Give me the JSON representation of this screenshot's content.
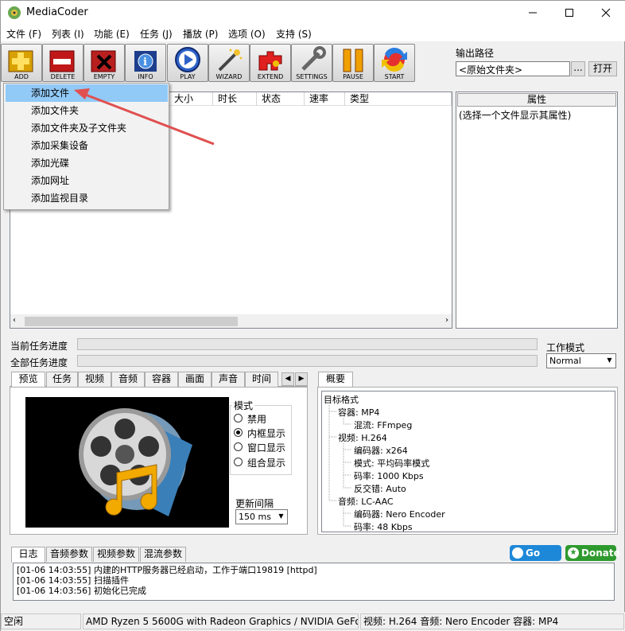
{
  "window": {
    "title": "MediaCoder"
  },
  "menubar": [
    "文件 (F)",
    "列表 (I)",
    "功能 (E)",
    "任务 (J)",
    "播放 (P)",
    "选项 (O)",
    "支持 (S)"
  ],
  "toolbar": {
    "buttons": [
      {
        "label": "ADD",
        "icon": "add-icon"
      },
      {
        "label": "DELETE",
        "icon": "delete-icon"
      },
      {
        "label": "EMPTY",
        "icon": "empty-icon"
      },
      {
        "label": "INFO",
        "icon": "info-icon"
      },
      {
        "label": "PLAY",
        "icon": "play-icon"
      },
      {
        "label": "WIZARD",
        "icon": "wizard-icon"
      },
      {
        "label": "EXTEND",
        "icon": "extend-icon"
      },
      {
        "label": "SETTINGS",
        "icon": "settings-icon"
      },
      {
        "label": "PAUSE",
        "icon": "pause-icon"
      },
      {
        "label": "START",
        "icon": "start-icon"
      }
    ]
  },
  "output": {
    "label": "输出路径",
    "value": "<原始文件夹>",
    "browse": "...",
    "open": "打开"
  },
  "file_list": {
    "columns": [
      "大小",
      "时长",
      "状态",
      "速率",
      "类型"
    ]
  },
  "properties": {
    "header": "属性",
    "hint": "(选择一个文件显示其属性)"
  },
  "context_menu": {
    "items": [
      "添加文件",
      "添加文件夹",
      "添加文件夹及子文件夹",
      "添加采集设备",
      "添加光碟",
      "添加网址",
      "添加监视目录"
    ],
    "highlighted": 0
  },
  "progress": {
    "current_label": "当前任务进度",
    "total_label": "全部任务进度"
  },
  "work_mode": {
    "label": "工作模式",
    "value": "Normal"
  },
  "left_tabs": [
    "预览",
    "任务",
    "视频",
    "音频",
    "容器",
    "画面",
    "声音",
    "时间"
  ],
  "preview": {
    "mode_label": "模式",
    "modes": [
      "禁用",
      "内框显示",
      "窗口显示",
      "组合显示"
    ],
    "selected_mode": 1,
    "refresh_label": "更新间隔",
    "refresh_value": "150 ms"
  },
  "summary": {
    "tab": "概要",
    "tree": [
      {
        "level": 0,
        "text": "目标格式"
      },
      {
        "level": 1,
        "text": "容器: MP4"
      },
      {
        "level": 2,
        "text": "混流: FFmpeg"
      },
      {
        "level": 1,
        "text": "视频: H.264"
      },
      {
        "level": 2,
        "text": "编码器: x264"
      },
      {
        "level": 2,
        "text": "模式: 平均码率模式"
      },
      {
        "level": 2,
        "text": "码率: 1000 Kbps"
      },
      {
        "level": 2,
        "text": "反交错: Auto"
      },
      {
        "level": 1,
        "text": "音频: LC-AAC"
      },
      {
        "level": 2,
        "text": "编码器: Nero Encoder"
      },
      {
        "level": 2,
        "text": "码率: 48 Kbps"
      }
    ]
  },
  "bottom_tabs": [
    "日志",
    "音频参数",
    "视频参数",
    "混流参数"
  ],
  "promo": {
    "gopro": "Go PRO",
    "donate": "Donate"
  },
  "log": [
    "[01-06 14:03:55] 内建的HTTP服务器已经启动，工作于端口19819 [httpd]",
    "[01-06 14:03:55] 扫描插件",
    "[01-06 14:03:56] 初始化已完成"
  ],
  "status": {
    "state": "空闲",
    "hardware": "AMD Ryzen 5 5600G with Radeon Graphics  / NVIDIA GeFo",
    "summary": "视频: H.264  音频: Nero Encoder  容器: MP4"
  },
  "colors": {
    "highlight": "#91c9f7",
    "arrow": "#e05050",
    "gopro": "#1e88d8",
    "donate": "#2e9a2e"
  }
}
